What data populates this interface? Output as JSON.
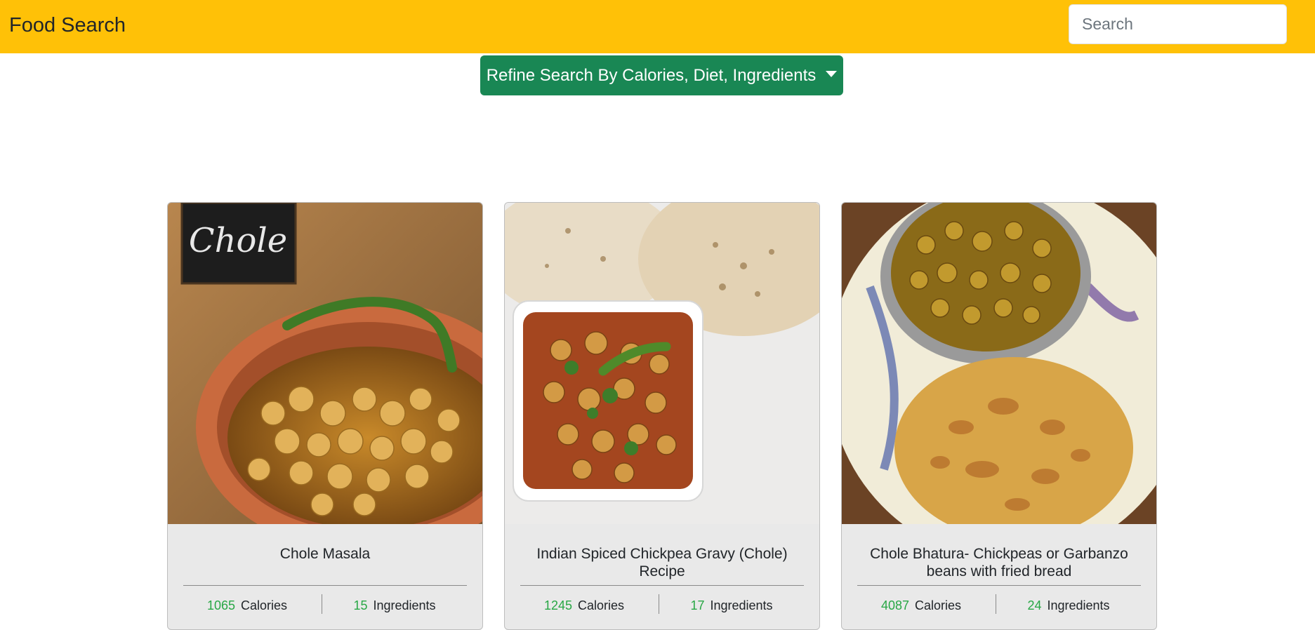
{
  "navbar": {
    "brand": "Food Search",
    "search_placeholder": "Search"
  },
  "refine_button": {
    "label": "Refine Search By Calories, Diet, Ingredients"
  },
  "recipes": [
    {
      "title": "Chole Masala",
      "calories": "1065",
      "calories_label": "Calories",
      "ingredients": "15",
      "ingredients_label": "Ingredients"
    },
    {
      "title": "Indian Spiced Chickpea Gravy (Chole) Recipe",
      "calories": "1245",
      "calories_label": "Calories",
      "ingredients": "17",
      "ingredients_label": "Ingredients"
    },
    {
      "title": "Chole Bhatura- Chickpeas or Garbanzo beans with fried bread",
      "calories": "4087",
      "calories_label": "Calories",
      "ingredients": "24",
      "ingredients_label": "Ingredients"
    }
  ],
  "colors": {
    "navbar": "#ffc107",
    "refine_button": "#198754",
    "stat_number": "#28a745",
    "card_bg": "#e9e9e9"
  }
}
